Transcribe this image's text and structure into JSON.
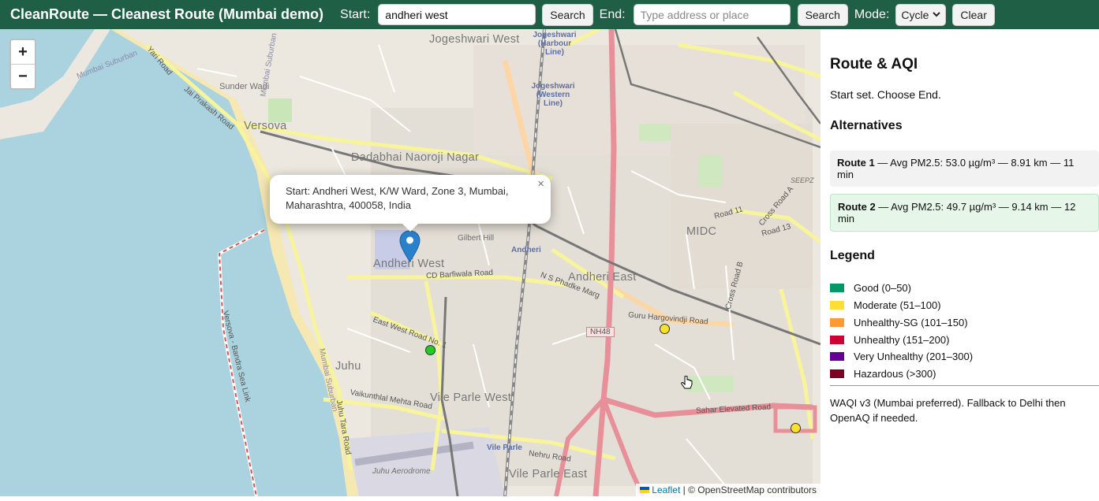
{
  "header": {
    "title": "CleanRoute — Cleanest Route (Mumbai demo)",
    "start_label": "Start:",
    "start_value": "andheri west",
    "start_search": "Search",
    "end_label": "End:",
    "end_placeholder": "Type address or place",
    "end_search": "Search",
    "mode_label": "Mode:",
    "mode_value": "Cycle",
    "clear": "Clear"
  },
  "map": {
    "zoom_in": "+",
    "zoom_out": "−",
    "popup_text": "Start: Andheri West, K/W Ward, Zone 3, Mumbai, Maharashtra, 400058, India",
    "popup_close": "×",
    "labels": {
      "jogeshwari_west": "Jogeshwari West",
      "versova": "Versova",
      "dadabhai": "Dadabhai Naoroji Nagar",
      "andheri_west": "Andheri West",
      "andheri_east": "Andheri East",
      "juhu": "Juhu",
      "vile_parle_west": "Vile Parle West",
      "vile_parle_east": "Vile Parle East",
      "midc": "MIDC",
      "sunder_wadi": "Sunder Wadi",
      "gilbert_hill": "Gilbert Hill",
      "juhu_aerodrome": "Juhu Aerodrome",
      "seepz": "SEEPZ",
      "nh48": "NH48",
      "mumbai_suburban_1": "Mumbai Suburban",
      "mumbai_suburban_2": "Mumbai Suburban",
      "mumbai_suburban_3": "Mumbai Suburban",
      "jogeshwari_harbour": "Jogeshwari (Harbour Line)",
      "jogeshwari_western": "Jogeshwari (Western Line)",
      "andheri_station": "Andheri",
      "vile_parle_station": "Vile Parle",
      "yari_road": "Yari Road",
      "jp_road": "Jai Prakash Road",
      "cd_barfiwala": "CD Barfiwala Road",
      "n_s_phadke": "N S Phadke Marg",
      "guru_hargovindji": "Guru Hargovindji Road",
      "east_west_road": "East West Road No. 1",
      "vaikunthlal": "Vaikunthlal Mehta Road",
      "juhu_tara": "Juhu Tara Road",
      "sahar_elevated": "Sahar Elevated Road",
      "nehru_road": "Nehru Road",
      "bandra_sea_link": "Versova - Bandra Sea Link",
      "road_11": "Road 11",
      "road_13": "Road 13",
      "cross_road_a": "Cross Road A",
      "cross_road_b": "Cross Road B"
    },
    "attribution_leaflet": "Leaflet",
    "attribution_rest": "| © OpenStreetMap contributors"
  },
  "panel": {
    "title": "Route & AQI",
    "status": "Start set. Choose End.",
    "alternatives_heading": "Alternatives",
    "routes": [
      {
        "name": "Route 1",
        "details": " — Avg PM2.5: 53.0 µg/m³ — 8.91 km — 11 min"
      },
      {
        "name": "Route 2",
        "details": " — Avg PM2.5: 49.7 µg/m³ — 9.14 km — 12 min"
      }
    ],
    "legend_heading": "Legend",
    "legend": [
      {
        "label": "Good (0–50)",
        "color": "#009966"
      },
      {
        "label": "Moderate (51–100)",
        "color": "#ffde33"
      },
      {
        "label": "Unhealthy-SG (101–150)",
        "color": "#ff9933"
      },
      {
        "label": "Unhealthy (151–200)",
        "color": "#cc0033"
      },
      {
        "label": "Very Unhealthy (201–300)",
        "color": "#660099"
      },
      {
        "label": "Hazardous (>300)",
        "color": "#7e0023"
      }
    ],
    "footnote": "WAQI v3 (Mumbai preferred). Fallback to Delhi then OpenAQ if needed."
  },
  "colors": {
    "header_bg": "#1f5f45",
    "marker": "#2a81cb",
    "selected_route_bg": "#e6f7ea",
    "route_bg": "#f2f2f2"
  }
}
